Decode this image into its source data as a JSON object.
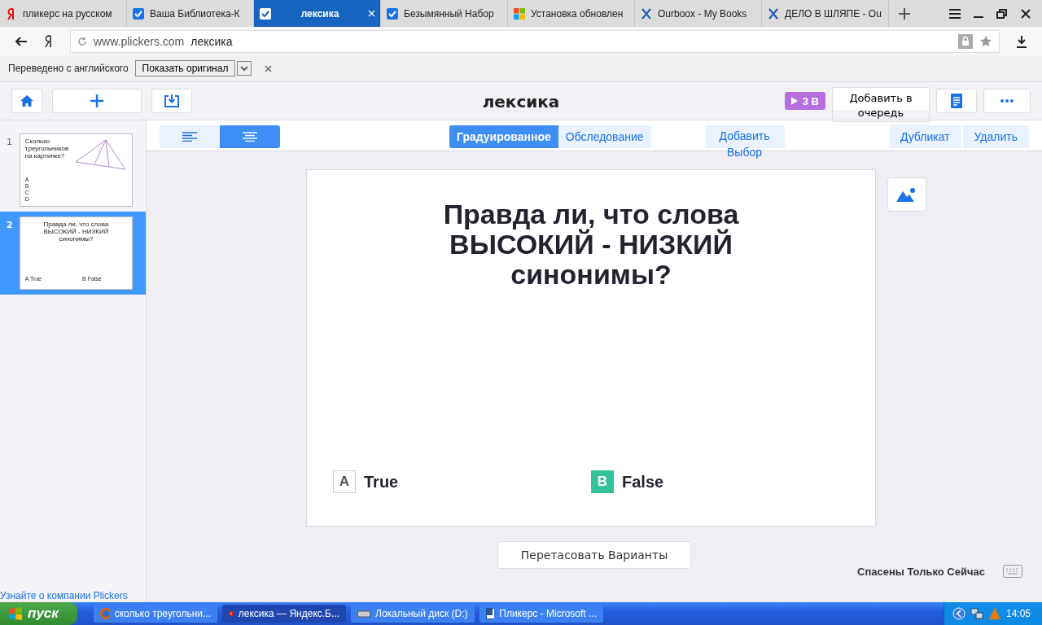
{
  "browser": {
    "tabs": [
      {
        "label": "пликерс на русском",
        "selected": false
      },
      {
        "label": "Ваша Библиотека-К",
        "selected": false
      },
      {
        "label": "лексика",
        "selected": true
      },
      {
        "label": "Безымянный Набор",
        "selected": false
      },
      {
        "label": "Установка обновлен",
        "selected": false
      },
      {
        "label": "Ourboox - My Books",
        "selected": false
      },
      {
        "label": "ДЕЛО В ШЛЯПЕ - Ou",
        "selected": false
      }
    ],
    "address": {
      "domain": "www.plickers.com",
      "title": "лексика"
    },
    "translate_bar": {
      "message": "Переведено с английского",
      "button": "Показать оригинал"
    }
  },
  "header": {
    "title": "лексика",
    "play_badge": "3 В",
    "queue_button": "Добавить в очередь"
  },
  "sidebar": {
    "slides": [
      {
        "number": "1",
        "selected": false,
        "question": "Сколько треугольников на картинке?",
        "has_figure": true,
        "choices": [
          "A",
          "B",
          "C",
          "D"
        ]
      },
      {
        "number": "2",
        "selected": true,
        "question": "Правда ли, что слова ВЫСОКИЙ - НИЗКИЙ синонимы?",
        "has_figure": false,
        "choices": [
          "A  True",
          "B  False"
        ]
      }
    ],
    "footer_link": "Узнайте о компании Plickers"
  },
  "toolbar": {
    "layouts": [
      {
        "kind": "left",
        "selected": false
      },
      {
        "kind": "center",
        "selected": true
      }
    ],
    "modes": [
      {
        "label": "Градуированное",
        "selected": true
      },
      {
        "label": "Обследование",
        "selected": false
      }
    ],
    "add_choice": "Добавить Выбор",
    "actions": [
      "Дубликат",
      "Удалить"
    ]
  },
  "question": {
    "text": "Правда ли, что слова ВЫСОКИЙ - НИЗКИЙ синонимы?",
    "choices": [
      {
        "letter": "A",
        "text": "True",
        "correct": false
      },
      {
        "letter": "B",
        "text": "False",
        "correct": true
      }
    ]
  },
  "shuffle_button": "Перетасовать Варианты",
  "save_status": "Спасены Только Сейчас",
  "taskbar": {
    "start": "пуск",
    "tasks": [
      {
        "label": "сколько треугольни...",
        "selected": false
      },
      {
        "label": "лексика — Яндекс.Б...",
        "selected": true
      },
      {
        "label": "Локальный диск (D:)",
        "selected": false
      },
      {
        "label": "Пликерс - Microsoft ...",
        "selected": false
      }
    ],
    "clock": "14:05"
  }
}
